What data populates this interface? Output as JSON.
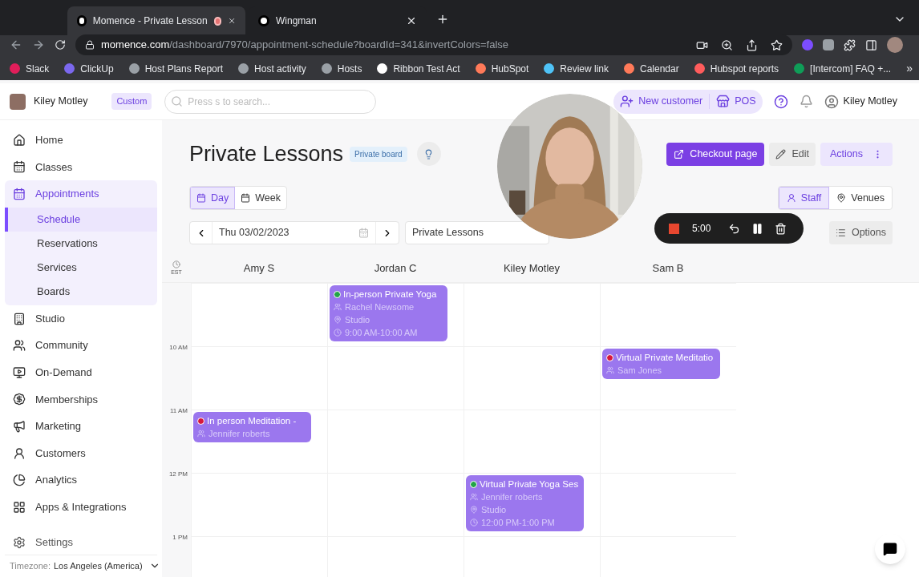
{
  "browser": {
    "tabs": [
      {
        "title": "Momence - Private Lesson",
        "selected": true,
        "recording": true
      },
      {
        "title": "Wingman",
        "selected": false,
        "recording": false
      }
    ],
    "url_host": "momence.com",
    "url_path": "/dashboard/7970/appointment-schedule?boardId=341&invertColors=false",
    "bookmarks": [
      {
        "label": "Slack",
        "color": "#e01e5a"
      },
      {
        "label": "ClickUp",
        "color": "#7b68ee"
      },
      {
        "label": "Host Plans Report",
        "color": "#9aa0a6"
      },
      {
        "label": "Host activity",
        "color": "#9aa0a6"
      },
      {
        "label": "Hosts",
        "color": "#9aa0a6"
      },
      {
        "label": "Ribbon Test Act",
        "color": "#ffffff"
      },
      {
        "label": "HubSpot",
        "color": "#ff7a59"
      },
      {
        "label": "Review link",
        "color": "#4fc3f7"
      },
      {
        "label": "Calendar",
        "color": "#ff7a59"
      },
      {
        "label": "Hubspot reports",
        "color": "#ff5c5c"
      },
      {
        "label": "[Intercom] FAQ +...",
        "color": "#0f9d58"
      }
    ],
    "more": "»"
  },
  "header": {
    "user": "Kiley Motley",
    "plan_badge": "Custom",
    "search": {
      "placeholder": "Press s to search..."
    },
    "actions": [
      "New customer",
      "POS"
    ],
    "account": "Kiley Motley"
  },
  "sidebar": {
    "items": [
      {
        "label": "Home",
        "selected": false
      },
      {
        "label": "Classes",
        "selected": false
      },
      {
        "label": "Appointments",
        "selected": false,
        "expanded": true,
        "children": [
          {
            "label": "Schedule",
            "selected": true
          },
          {
            "label": "Reservations",
            "selected": false
          },
          {
            "label": "Services",
            "selected": false
          },
          {
            "label": "Boards",
            "selected": false
          }
        ]
      },
      {
        "label": "Studio",
        "selected": false
      },
      {
        "label": "Community",
        "selected": false
      },
      {
        "label": "On-Demand",
        "selected": false
      },
      {
        "label": "Memberships",
        "selected": false
      },
      {
        "label": "Marketing",
        "selected": false
      },
      {
        "label": "Customers",
        "selected": false
      },
      {
        "label": "Analytics",
        "selected": false
      },
      {
        "label": "Apps & Integrations",
        "selected": false
      }
    ],
    "settings": "Settings",
    "timezone_label": "Timezone:",
    "timezone": "Los Angeles (America)"
  },
  "page": {
    "title": "Private Lessons",
    "badge": "Private board",
    "buttons": [
      "Checkout page",
      "Edit",
      "Actions"
    ],
    "views": [
      {
        "label": "Day",
        "selected": true
      },
      {
        "label": "Week",
        "selected": false
      }
    ],
    "groupings": [
      {
        "label": "Staff",
        "selected": true
      },
      {
        "label": "Venues",
        "selected": false
      }
    ],
    "date": "Thu 03/02/2023",
    "board": "Private Lessons",
    "options": "Options"
  },
  "calendar": {
    "timezone": "EST",
    "columns": [
      "Amy S",
      "Jordan C",
      "Kiley Motley",
      "Sam B"
    ],
    "rows": [
      {
        "cells": [
          null,
          {
            "title": "In-person Private Yoga",
            "color": "#22a447",
            "attendee": "Rachel Newsome",
            "location": "Studio",
            "time": "9:00 AM-10:00 AM"
          },
          null,
          null
        ]
      },
      {
        "time": "10 AM",
        "cells": [
          null,
          null,
          null,
          {
            "title": "Virtual Private Meditatio",
            "color": "#d6173c",
            "attendee": "Sam Jones"
          }
        ]
      },
      {
        "time": "11 AM",
        "cells": [
          {
            "title": "In person Meditation -",
            "color": "#d6173c",
            "attendee": "Jennifer roberts"
          },
          null,
          null,
          null
        ]
      },
      {
        "time": "12 PM",
        "cells": [
          null,
          null,
          {
            "title": "Virtual Private Yoga Ses",
            "color": "#22a447",
            "attendee": "Jennifer roberts",
            "location": "Studio",
            "time": "12:00 PM-1:00 PM"
          },
          null
        ]
      },
      {
        "time": "1 PM",
        "cells": [
          null,
          null,
          null,
          null
        ]
      }
    ]
  },
  "recorder": {
    "elapsed": "5:00"
  }
}
